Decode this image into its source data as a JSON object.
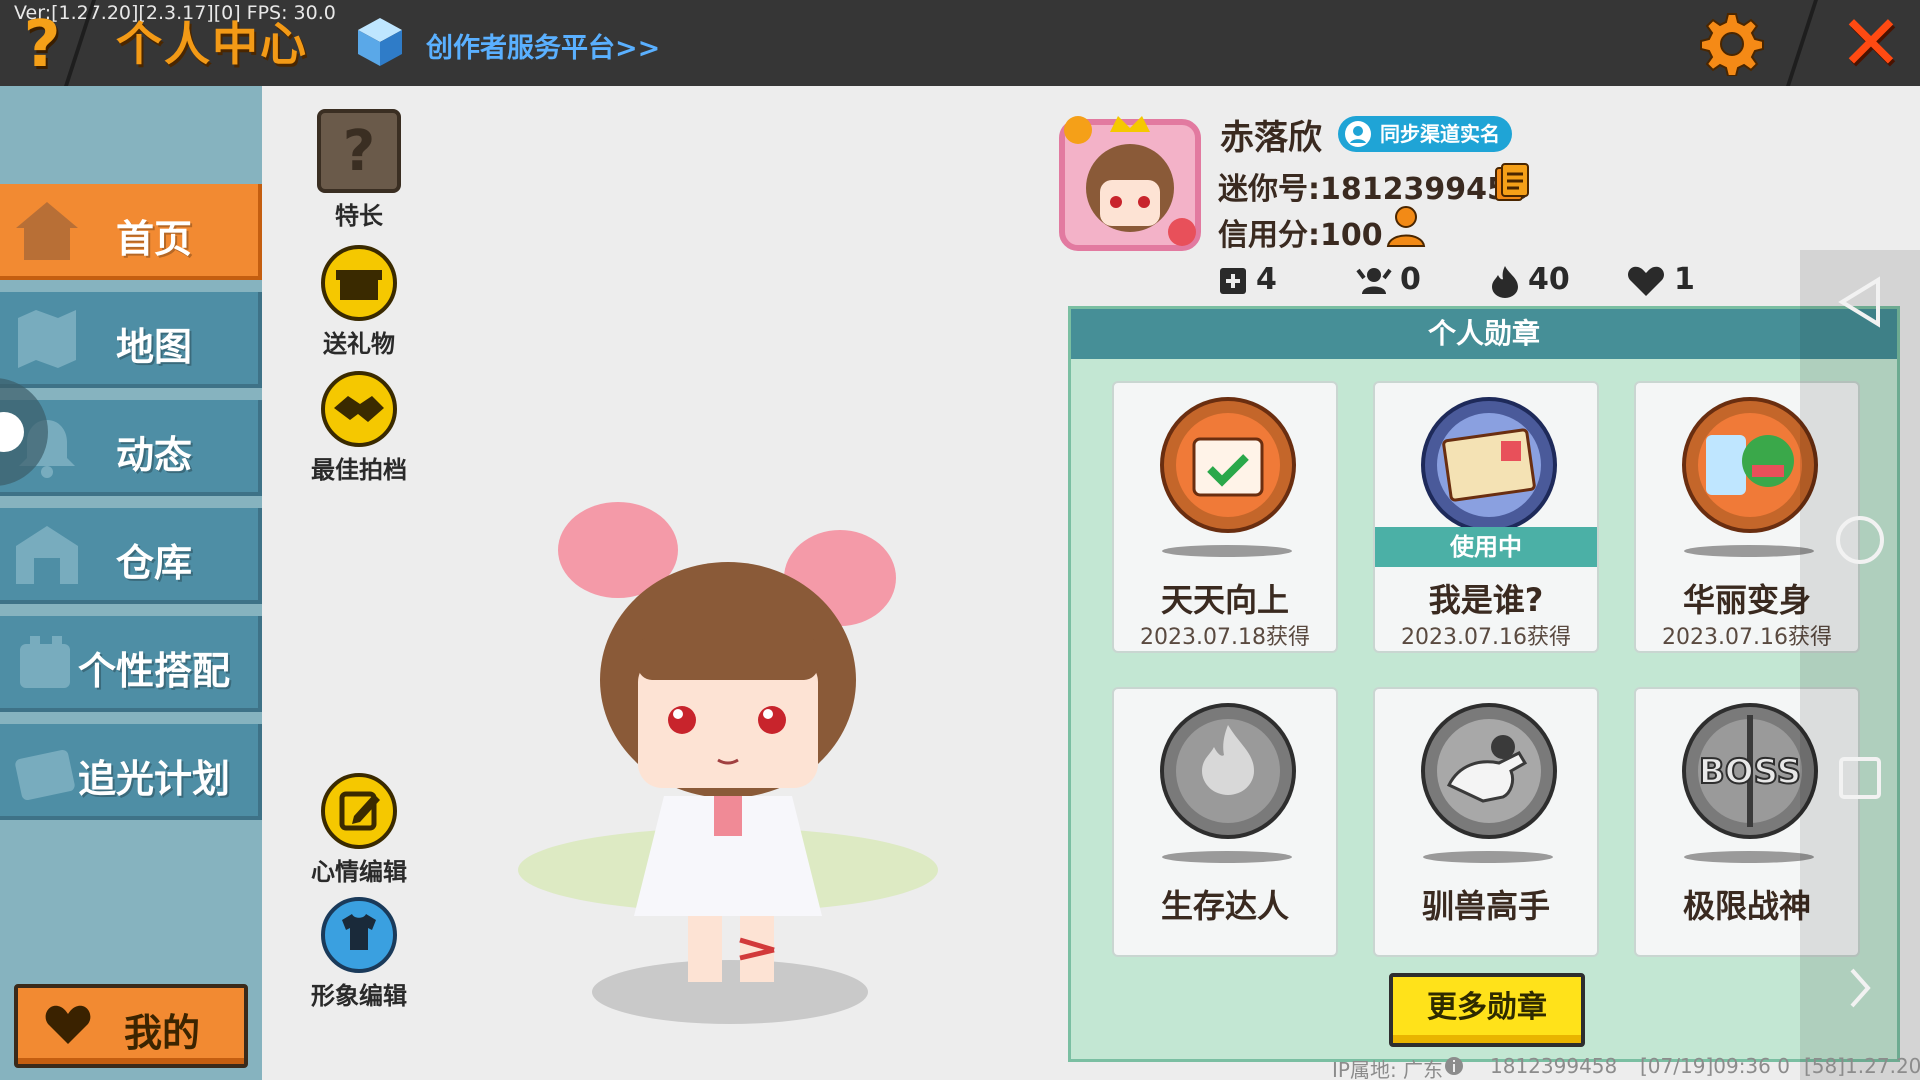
{
  "topbar": {
    "version": "Ver:[1.27.20][2.3.17][0] FPS: 30.0",
    "help_label": "?",
    "title": "个人中心",
    "creator_link": "创作者服务平台>>",
    "close_label": "✕"
  },
  "sidebar": {
    "items": [
      {
        "label": "首页",
        "icon": "house-icon",
        "active": true
      },
      {
        "label": "地图",
        "icon": "map-icon"
      },
      {
        "label": "动态",
        "icon": "bell-icon"
      },
      {
        "label": "仓库",
        "icon": "warehouse-icon"
      },
      {
        "label": "个性搭配",
        "icon": "outfit-icon"
      },
      {
        "label": "追光计划",
        "icon": "plan-icon"
      }
    ],
    "mine_label": "我的"
  },
  "tools": {
    "specialty_icon_text": "?",
    "specialty": "特长",
    "gift": "送礼物",
    "best_photo": "最佳拍档",
    "mood_edit": "心情编辑",
    "image_edit": "形象编辑"
  },
  "profile": {
    "nickname": "赤落欣",
    "sync_badge": "同步渠道实名",
    "mini_id": "迷你号:1812399458",
    "credit": "信用分:100",
    "stats": {
      "friends": "4",
      "fans": "0",
      "popularity": "40",
      "likes": "1"
    }
  },
  "medals": {
    "title": "个人勋章",
    "items": [
      {
        "name": "天天向上",
        "date": "2023.07.18获得",
        "in_use": false
      },
      {
        "name": "我是谁?",
        "date": "2023.07.16获得",
        "in_use": true
      },
      {
        "name": "华丽变身",
        "date": "2023.07.16获得",
        "in_use": false
      },
      {
        "name": "生存达人",
        "date": ""
      },
      {
        "name": "驯兽高手",
        "date": ""
      },
      {
        "name": "极限战神",
        "date": ""
      }
    ],
    "in_use_label": "使用中",
    "boss_text": "BOSS",
    "more_button": "更多勋章"
  },
  "footer": {
    "ip": "IP属地: 广东",
    "uid": "1812399458",
    "timestamp": "[07/19]09:36 0",
    "build": "[58]1.27.20"
  },
  "colors": {
    "accent_orange": "#f28a32",
    "sidebar_blue": "#4e8ea5",
    "medal_panel": "#c3e7d3",
    "button_yellow": "#ffe21a"
  }
}
